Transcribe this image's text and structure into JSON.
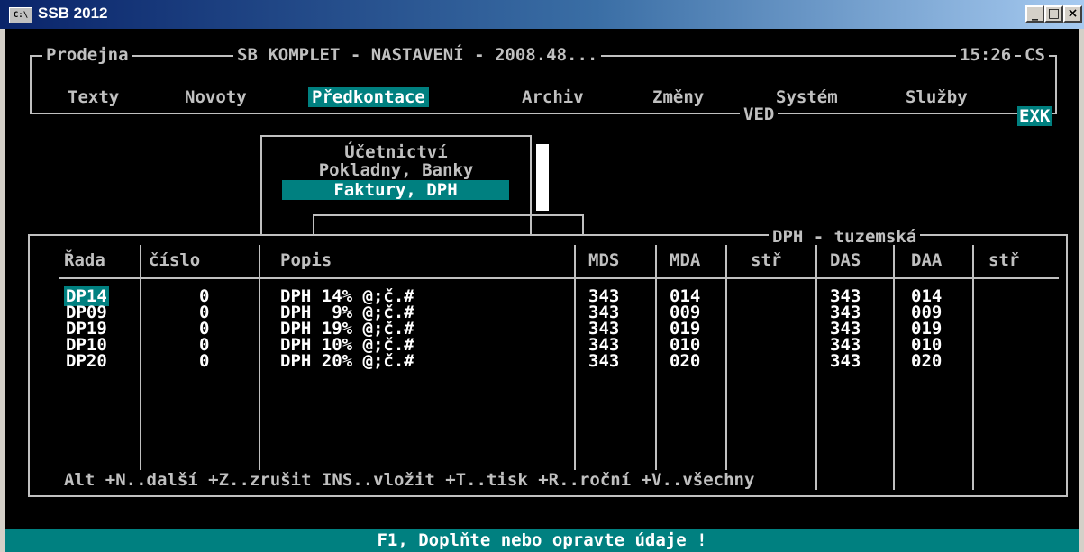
{
  "window": {
    "title": "SSB 2012",
    "icon_text": "C:\\"
  },
  "header": {
    "left_label": "Prodejna",
    "title": "SB KOMPLET - NASTAVENÍ - 2008.48...",
    "time": "15:26",
    "lang": "CS",
    "ved_label": "VED",
    "exk_label": "EXK"
  },
  "menu": {
    "items": [
      {
        "label": "Texty"
      },
      {
        "label": "Novoty"
      },
      {
        "label": "Předkontace"
      },
      {
        "label": "Archiv"
      },
      {
        "label": "Změny"
      },
      {
        "label": "Systém"
      },
      {
        "label": "Služby"
      }
    ],
    "selected": "Předkontace"
  },
  "submenu": {
    "items": [
      {
        "label": "Účetnictví"
      },
      {
        "label": "Pokladny, Banky"
      },
      {
        "label": "Faktury, DPH"
      }
    ],
    "selected": "Faktury, DPH"
  },
  "table_panel": {
    "title": "DPH - tuzemská",
    "columns": [
      "Řada",
      "číslo",
      "Popis",
      "MDS",
      "MDA",
      "stř",
      "DAS",
      "DAA",
      "stř"
    ],
    "rows": [
      {
        "rada": "DP14",
        "cislo": "0",
        "popis": "DPH 14% @;č.#",
        "mds": "343",
        "mda": "014",
        "str1": "",
        "das": "343",
        "daa": "014",
        "str2": ""
      },
      {
        "rada": "DP09",
        "cislo": "0",
        "popis": "DPH  9% @;č.#",
        "mds": "343",
        "mda": "009",
        "str1": "",
        "das": "343",
        "daa": "009",
        "str2": ""
      },
      {
        "rada": "DP19",
        "cislo": "0",
        "popis": "DPH 19% @;č.#",
        "mds": "343",
        "mda": "019",
        "str1": "",
        "das": "343",
        "daa": "019",
        "str2": ""
      },
      {
        "rada": "DP10",
        "cislo": "0",
        "popis": "DPH 10% @;č.#",
        "mds": "343",
        "mda": "010",
        "str1": "",
        "das": "343",
        "daa": "010",
        "str2": ""
      },
      {
        "rada": "DP20",
        "cislo": "0",
        "popis": "DPH 20% @;č.#",
        "mds": "343",
        "mda": "020",
        "str1": "",
        "das": "343",
        "daa": "020",
        "str2": ""
      }
    ],
    "selected_row": "DP14",
    "footer": "Alt +N..další +Z..zrušit INS..vložit +T..tisk +R..roční +V..všechny"
  },
  "status": {
    "text": "F1, Doplňte nebo opravte údaje !"
  },
  "colors": {
    "console_bg": "#000000",
    "console_fg": "#c0c0c0",
    "highlight": "#008080",
    "title_gradient_start": "#0a246a"
  }
}
